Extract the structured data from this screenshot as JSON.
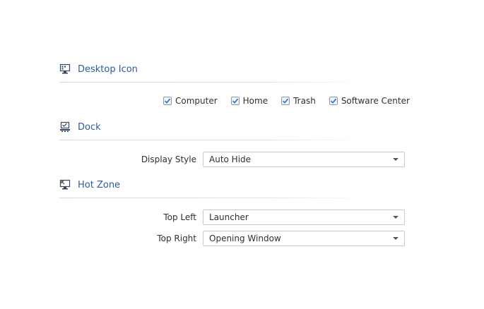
{
  "desktop_icon": {
    "title": "Desktop Icon",
    "items": [
      {
        "label": "Computer",
        "checked": true
      },
      {
        "label": "Home",
        "checked": true
      },
      {
        "label": "Trash",
        "checked": true
      },
      {
        "label": "Software Center",
        "checked": true
      }
    ]
  },
  "dock": {
    "title": "Dock",
    "display_style": {
      "label": "Display Style",
      "value": "Auto Hide"
    }
  },
  "hot_zone": {
    "title": "Hot Zone",
    "top_left": {
      "label": "Top Left",
      "value": "Launcher"
    },
    "top_right": {
      "label": "Top Right",
      "value": "Opening Window"
    }
  },
  "colors": {
    "accent": "#2d5a9e",
    "check": "#2a6fbf"
  }
}
